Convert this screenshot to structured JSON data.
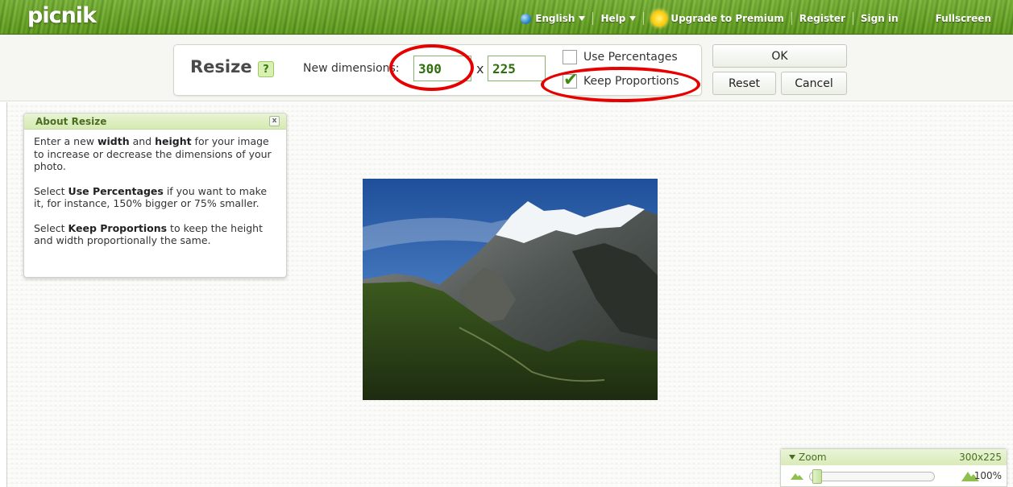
{
  "app": {
    "logo": "picnik"
  },
  "topnav": {
    "language": "English",
    "help": "Help",
    "upgrade": "Upgrade to Premium",
    "register": "Register",
    "signin": "Sign in",
    "fullscreen": "Fullscreen"
  },
  "resize": {
    "title": "Resize",
    "help_badge": "?",
    "dimensions_label": "New dimensions:",
    "width": "300",
    "separator": "x",
    "height": "225",
    "use_percentages_label": "Use Percentages",
    "use_percentages_checked": false,
    "keep_proportions_label": "Keep Proportions",
    "keep_proportions_checked": true,
    "ok_label": "OK",
    "reset_label": "Reset",
    "cancel_label": "Cancel"
  },
  "about": {
    "title": "About Resize",
    "close": "x",
    "p1_pre": "Enter a new ",
    "p1_width": "width",
    "p1_and": " and ",
    "p1_height": "height",
    "p1_post": " for your image to increase or decrease the dimensions of your photo.",
    "p2_pre": "Select ",
    "p2_bold": "Use Percentages",
    "p2_post": " if you want to make it, for instance, 150% bigger or 75% smaller.",
    "p3_pre": "Select ",
    "p3_bold": "Keep Proportions",
    "p3_post": " to keep the height and width proportionally the same."
  },
  "zoom": {
    "label": "Zoom",
    "size": "300x225",
    "percent": "100%"
  },
  "colors": {
    "accent_green": "#3d8c12",
    "annotation_red": "#e60000"
  },
  "icons": {
    "globe": "globe-icon",
    "sun": "sun-icon",
    "checkmark": "checkmark-icon",
    "zoom_out": "mountain-small-icon",
    "zoom_in": "mountain-large-icon"
  }
}
